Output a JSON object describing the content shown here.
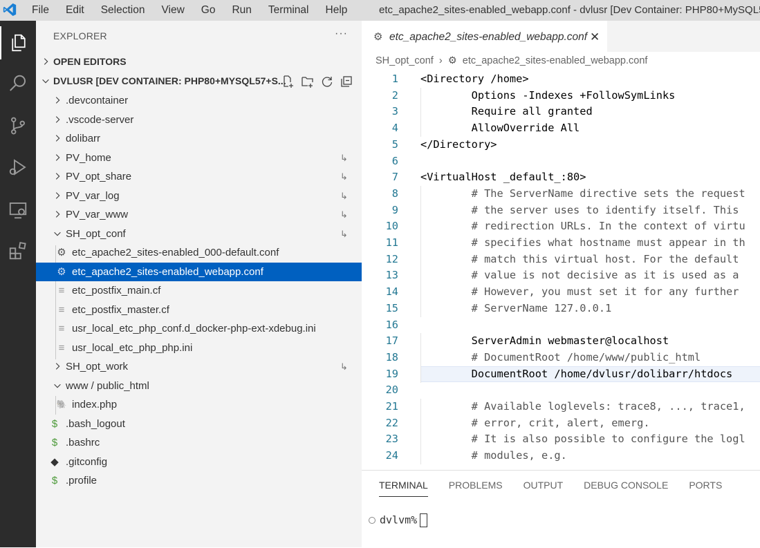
{
  "titlebar": {
    "menu": [
      "File",
      "Edit",
      "Selection",
      "View",
      "Go",
      "Run",
      "Terminal",
      "Help"
    ],
    "window_title": "etc_apache2_sites-enabled_webapp.conf - dvlusr [Dev Container: PHP80+MySQL5"
  },
  "activity_icons": [
    "explorer-icon",
    "search-icon",
    "source-control-icon",
    "run-debug-icon",
    "remote-explorer-icon",
    "extensions-icon"
  ],
  "sidebar": {
    "header": "EXPLORER",
    "more": "···",
    "open_editors": "OPEN EDITORS",
    "workspace": "DVLUSR [DEV CONTAINER: PHP80+MYSQL57+S...",
    "tree": [
      {
        "label": ".devcontainer",
        "kind": "folder",
        "open": false
      },
      {
        "label": ".vscode-server",
        "kind": "folder",
        "open": false
      },
      {
        "label": "dolibarr",
        "kind": "folder",
        "open": false
      },
      {
        "label": "PV_home",
        "kind": "folder",
        "open": false,
        "link": true
      },
      {
        "label": "PV_opt_share",
        "kind": "folder",
        "open": false,
        "link": true
      },
      {
        "label": "PV_var_log",
        "kind": "folder",
        "open": false,
        "link": true
      },
      {
        "label": "PV_var_www",
        "kind": "folder",
        "open": false,
        "link": true
      },
      {
        "label": "SH_opt_conf",
        "kind": "folder",
        "open": true,
        "link": true
      },
      {
        "label": "etc_apache2_sites-enabled_000-default.conf",
        "kind": "gear",
        "child": true
      },
      {
        "label": "etc_apache2_sites-enabled_webapp.conf",
        "kind": "gear",
        "child": true,
        "selected": true
      },
      {
        "label": "etc_postfix_main.cf",
        "kind": "lines",
        "child": true
      },
      {
        "label": "etc_postfix_master.cf",
        "kind": "lines",
        "child": true
      },
      {
        "label": "usr_local_etc_php_conf.d_docker-php-ext-xdebug.ini",
        "kind": "lines",
        "child": true
      },
      {
        "label": "usr_local_etc_php_php.ini",
        "kind": "lines",
        "child": true
      },
      {
        "label": "SH_opt_work",
        "kind": "folder",
        "open": false,
        "link": true
      },
      {
        "label": "www / public_html",
        "kind": "folder",
        "open": true
      },
      {
        "label": "index.php",
        "kind": "php",
        "child": true
      },
      {
        "label": ".bash_logout",
        "kind": "dollar"
      },
      {
        "label": ".bashrc",
        "kind": "dollar"
      },
      {
        "label": ".gitconfig",
        "kind": "git"
      },
      {
        "label": ".profile",
        "kind": "dollar"
      }
    ]
  },
  "editor": {
    "tab": "etc_apache2_sites-enabled_webapp.conf",
    "breadcrumb": [
      "SH_opt_conf",
      "etc_apache2_sites-enabled_webapp.conf"
    ],
    "highlight_line": 19,
    "lines": [
      "<Directory /home>",
      "        Options -Indexes +FollowSymLinks",
      "        Require all granted",
      "        AllowOverride All",
      "</Directory>",
      "",
      "<VirtualHost _default_:80>",
      "        # The ServerName directive sets the request",
      "        # the server uses to identify itself. This",
      "        # redirection URLs. In the context of virtu",
      "        # specifies what hostname must appear in th",
      "        # match this virtual host. For the default",
      "        # value is not decisive as it is used as a",
      "        # However, you must set it for any further",
      "        # ServerName 127.0.0.1",
      "",
      "        ServerAdmin webmaster@localhost",
      "        # DocumentRoot /home/www/public_html",
      "        DocumentRoot /home/dvlusr/dolibarr/htdocs",
      "",
      "        # Available loglevels: trace8, ..., trace1,",
      "        # error, crit, alert, emerg.",
      "        # It is also possible to configure the logl",
      "        # modules, e.g."
    ]
  },
  "panel": {
    "tabs": [
      "TERMINAL",
      "PROBLEMS",
      "OUTPUT",
      "DEBUG CONSOLE",
      "PORTS"
    ],
    "prompt": "dvlvm%"
  }
}
